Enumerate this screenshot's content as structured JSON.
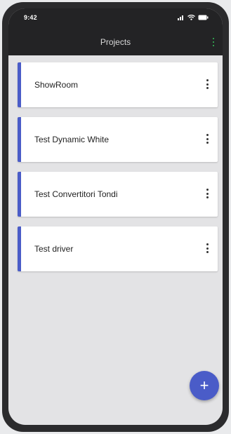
{
  "status_bar": {
    "time": "9:42",
    "icons": [
      "signal-icon",
      "wifi-icon",
      "battery-icon"
    ]
  },
  "app_bar": {
    "title": "Projects",
    "menu_icon": "more-vert-icon"
  },
  "projects": [
    {
      "label": "ShowRoom"
    },
    {
      "label": "Test Dynamic White"
    },
    {
      "label": "Test Convertitori Tondi"
    },
    {
      "label": "Test driver"
    }
  ],
  "fab": {
    "label": "+",
    "icon": "add-icon"
  },
  "colors": {
    "accent": "#4a5cc8",
    "app_bar_bg": "#232325",
    "screen_bg": "#e3e3e5",
    "menu_dots": "#35c05a"
  }
}
